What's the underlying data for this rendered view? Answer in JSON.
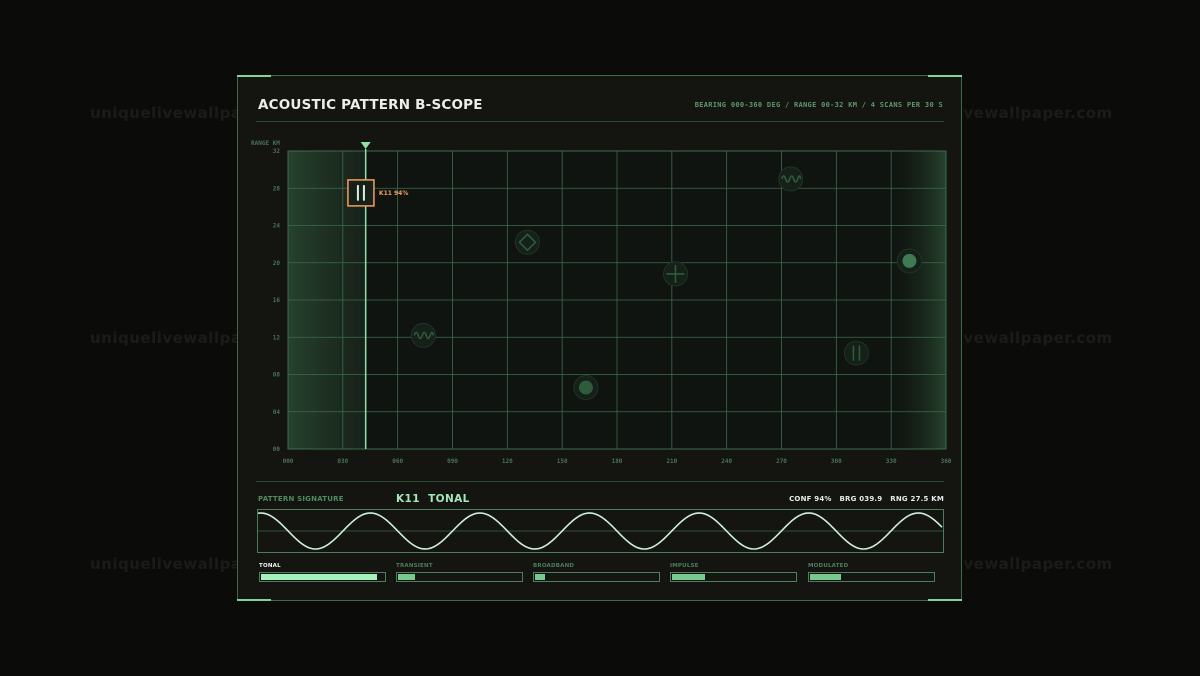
{
  "watermark": "uniquelivewallpaper.com",
  "header": {
    "title": "ACOUSTIC PATTERN B-SCOPE",
    "subtitle": "BEARING 000-360 DEG / RANGE 00-32 KM / 4 SCANS PER 30 S"
  },
  "scope": {
    "y_axis_label": "RANGE KM",
    "y_ticks": [
      "32",
      "28",
      "24",
      "20",
      "16",
      "12",
      "08",
      "04",
      "00"
    ],
    "x_ticks": [
      "000",
      "030",
      "060",
      "090",
      "120",
      "150",
      "180",
      "210",
      "240",
      "270",
      "300",
      "330",
      "360"
    ],
    "x_range": [
      0,
      360
    ],
    "y_range": [
      0,
      32
    ],
    "sweep_bearing": 42.5,
    "selected_contact": {
      "label": "K11 94%",
      "bearing": 39.9,
      "range_km": 27.5,
      "pattern": "tonal"
    },
    "contacts": [
      {
        "pattern": "modulated",
        "bearing": 275,
        "range_km": 29
      },
      {
        "pattern": "transient",
        "bearing": 131,
        "range_km": 22.2
      },
      {
        "pattern": "broadband",
        "bearing": 212,
        "range_km": 18.8
      },
      {
        "pattern": "impulse",
        "bearing": 340,
        "range_km": 20.2
      },
      {
        "pattern": "modulated",
        "bearing": 74,
        "range_km": 12.2
      },
      {
        "pattern": "tonal",
        "bearing": 311,
        "range_km": 10.3
      },
      {
        "pattern": "impulse",
        "bearing": 163,
        "range_km": 6.6
      }
    ],
    "colors": {
      "grid": "#3e6b4a",
      "sweep": "#8ee2a7",
      "selected": "#f2a060",
      "contact": "#2f5a3c"
    }
  },
  "signature": {
    "label": "PATTERN SIGNATURE",
    "id": "K11",
    "type": "TONAL",
    "stats": "CONF 94%   BRG 039.9   RNG 27.5 KM",
    "wave_cycles": 6.25
  },
  "meters": [
    {
      "label": "TONAL",
      "value": 0.94,
      "active": true
    },
    {
      "label": "TRANSIENT",
      "value": 0.14,
      "active": false
    },
    {
      "label": "BROADBAND",
      "value": 0.08,
      "active": false
    },
    {
      "label": "IMPULSE",
      "value": 0.27,
      "active": false
    },
    {
      "label": "MODULATED",
      "value": 0.25,
      "active": false
    }
  ]
}
